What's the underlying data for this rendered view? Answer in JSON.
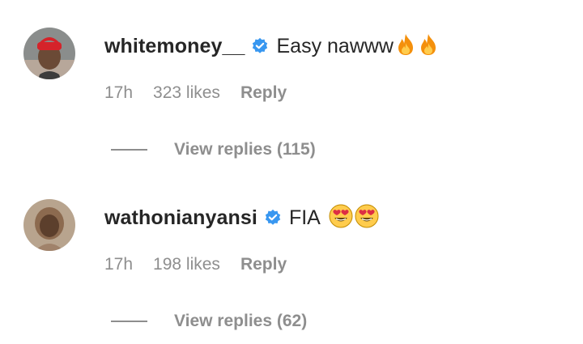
{
  "comments": [
    {
      "username": "whitemoney__",
      "text": "Easy nawww",
      "emojis": [
        "fire-emoji",
        "fire-emoji"
      ],
      "time": "17h",
      "likes": "323 likes",
      "reply_label": "Reply",
      "view_replies": "View replies (115)",
      "verified": true,
      "avatar_icon": "user-avatar-red-cap"
    },
    {
      "username": "wathonianyansi",
      "text": "FIA",
      "emojis": [
        "heart-eyes-emoji",
        "heart-eyes-emoji"
      ],
      "time": "17h",
      "likes": "198 likes",
      "reply_label": "Reply",
      "view_replies": "View replies (62)",
      "verified": true,
      "avatar_icon": "user-avatar"
    }
  ],
  "colors": {
    "verified_badge": "#3897f0",
    "primary_text": "#262626",
    "secondary_text": "#8e8e8e"
  }
}
